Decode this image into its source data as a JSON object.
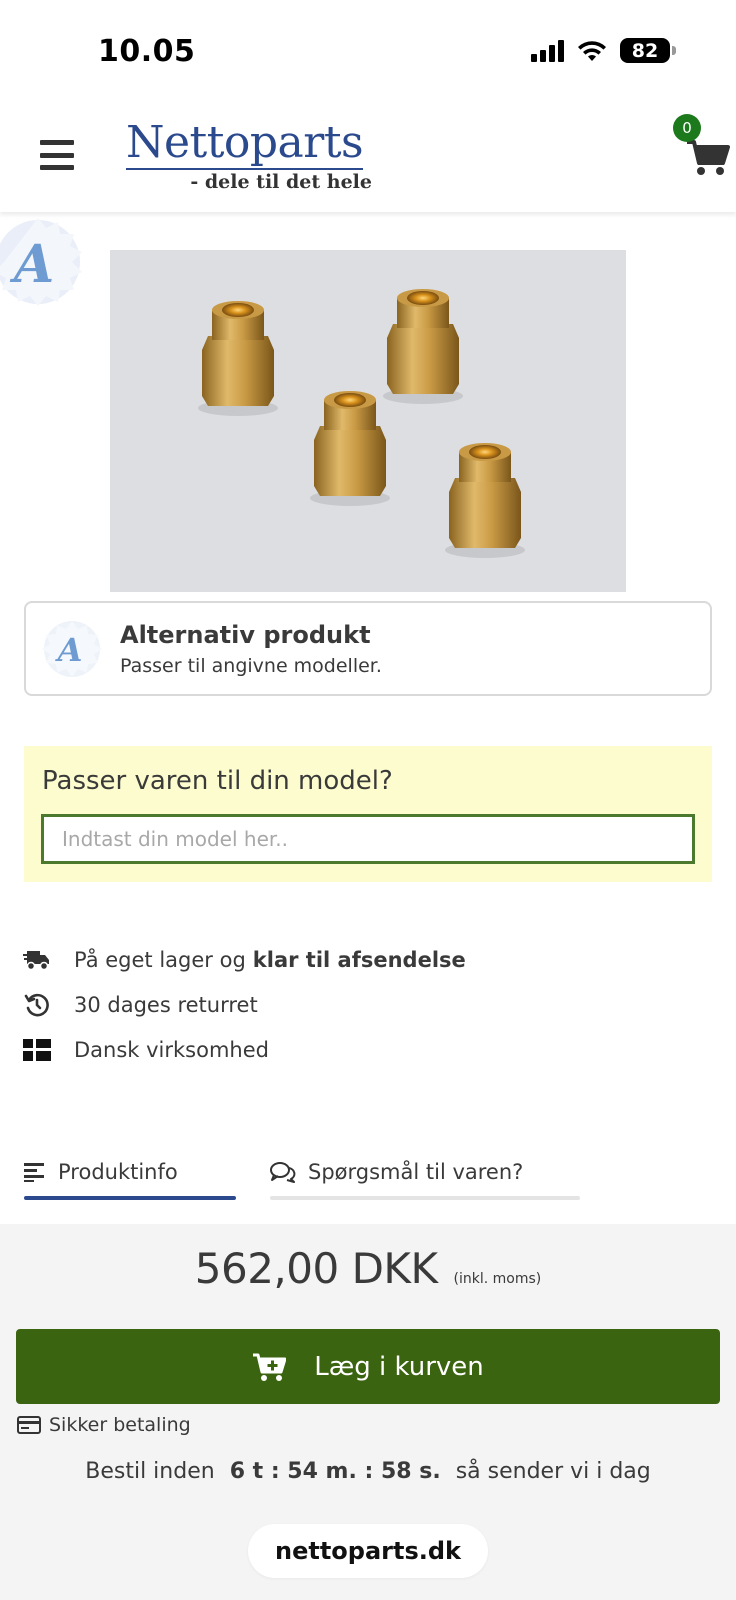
{
  "status_bar": {
    "time": "10.05",
    "battery": "82"
  },
  "header": {
    "logo_name": "Nettoparts",
    "logo_tagline": "- dele til det hele",
    "cart_count": "0",
    "menu_icon": "hamburger-icon",
    "cart_icon": "cart-icon"
  },
  "product": {
    "image_alt": "Brass nozzles",
    "alt_badge_letter": "A"
  },
  "alternative": {
    "title": "Alternativ produkt",
    "subtitle": "Passer til angivne modeller.",
    "icon_letter": "A"
  },
  "model_search": {
    "title": "Passer varen til din model?",
    "placeholder": "Indtast din model her.."
  },
  "usps": [
    {
      "icon": "delivery-truck-icon",
      "text": "På eget lager og",
      "bold": "klar til afsendelse"
    },
    {
      "icon": "history-icon",
      "text": "30 dages returret",
      "bold": ""
    },
    {
      "icon": "flag-icon",
      "text": "Dansk virksomhed",
      "bold": ""
    }
  ],
  "tabs": [
    {
      "icon": "list-icon",
      "label": "Produktinfo",
      "active": true
    },
    {
      "icon": "chat-icon",
      "label": "Spørgsmål til varen?",
      "active": false
    }
  ],
  "purchase": {
    "price": "562,00 DKK",
    "vat_note": "(inkl. moms)",
    "add_to_cart": "Læg i kurven",
    "secure_payment": "Sikker betaling",
    "deadline_prefix": "Bestil inden",
    "deadline_time": "6 t : 54 m. : 58 s.",
    "deadline_suffix": "så sender vi i dag"
  },
  "browser": {
    "url": "nettoparts.dk"
  },
  "colors": {
    "brand_blue": "#2b4a8e",
    "cta_green": "#3b6410",
    "badge_green": "#1c7a1c",
    "highlight_yellow": "#fdfccf",
    "tab_active": "#2b4a8e"
  }
}
